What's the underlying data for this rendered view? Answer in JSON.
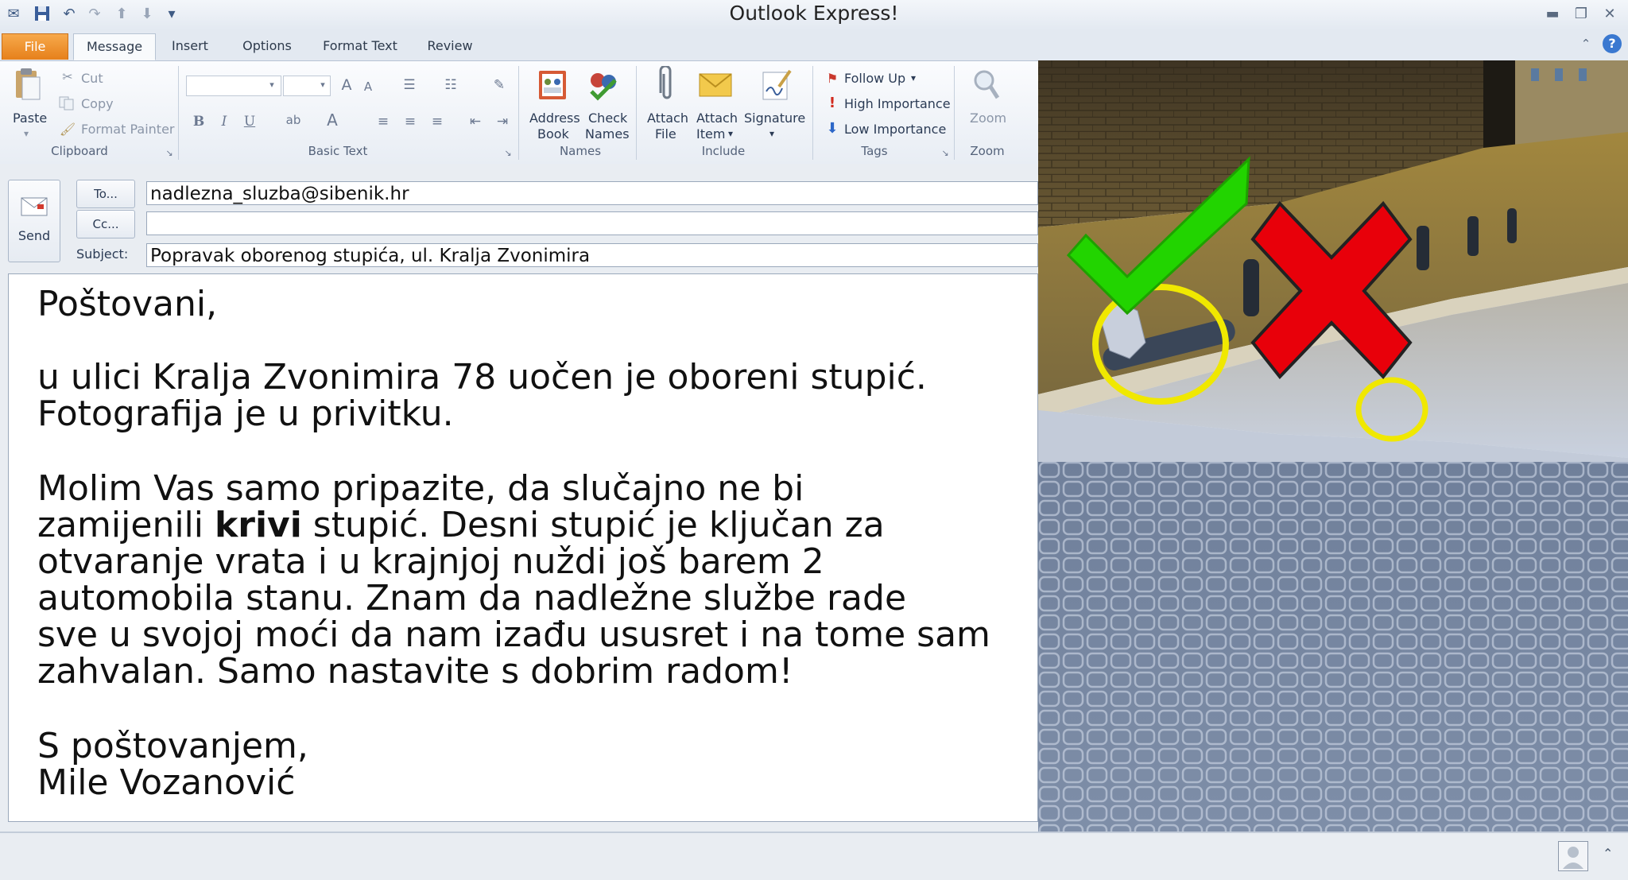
{
  "window": {
    "title": "Outlook Express!"
  },
  "tabs": [
    {
      "label": "File"
    },
    {
      "label": "Message"
    },
    {
      "label": "Insert"
    },
    {
      "label": "Options"
    },
    {
      "label": "Format Text"
    },
    {
      "label": "Review"
    }
  ],
  "ribbon": {
    "clipboard": {
      "paste": "Paste",
      "cut": "Cut",
      "copy": "Copy",
      "format_painter": "Format Painter",
      "group": "Clipboard"
    },
    "basic_text": {
      "group": "Basic Text",
      "bold": "B",
      "italic": "I",
      "underline": "U",
      "grow": "A",
      "font_color": "A"
    },
    "names": {
      "address_book_1": "Address",
      "address_book_2": "Book",
      "check_names_1": "Check",
      "check_names_2": "Names",
      "group": "Names"
    },
    "include": {
      "attach_file_1": "Attach",
      "attach_file_2": "File",
      "attach_item_1": "Attach",
      "attach_item_2": "Item",
      "signature": "Signature",
      "group": "Include"
    },
    "tags": {
      "follow_up": "Follow Up",
      "high_importance": "High Importance",
      "low_importance": "Low Importance",
      "group": "Tags"
    },
    "zoom": {
      "zoom": "Zoom",
      "group": "Zoom"
    }
  },
  "compose": {
    "send": "Send",
    "to_button": "To...",
    "cc_button": "Cc...",
    "subject_label": "Subject:",
    "to_value": "nadlezna_sluzba@sibenik.hr",
    "cc_value": "",
    "subject_value": "Popravak oborenog stupića, ul. Kralja Zvonimira"
  },
  "message": {
    "greeting": "Poštovani,",
    "p1_line1": "u ulici Kralja Zvonimira 78 uočen je oboreni stupić.",
    "p1_line2": "Fotografija je u privitku.",
    "p2_line1": "Molim Vas samo pripazite, da slučajno ne bi",
    "p2_line2_a": "zamijenili ",
    "p2_line2_bold": "krivi",
    "p2_line2_b": " stupić. Desni stupić je ključan za",
    "p2_line3": "otvaranje vrata i u krajnjoj nuždi još barem 2",
    "p2_line4": "automobila stanu. Znam da nadležne službe rade",
    "p2_line5": "sve u svojoj moći da nam izađu ususret i na tome sam",
    "p2_line6": "zahvalan. Samo nastavite s dobrim radom!",
    "closing": "S poštovanjem,",
    "signature": "Mile Vozanović"
  },
  "photo": {
    "check_mark_color": "#22d400",
    "x_mark_color": "#e8000a",
    "circle_color": "#f0e800"
  }
}
